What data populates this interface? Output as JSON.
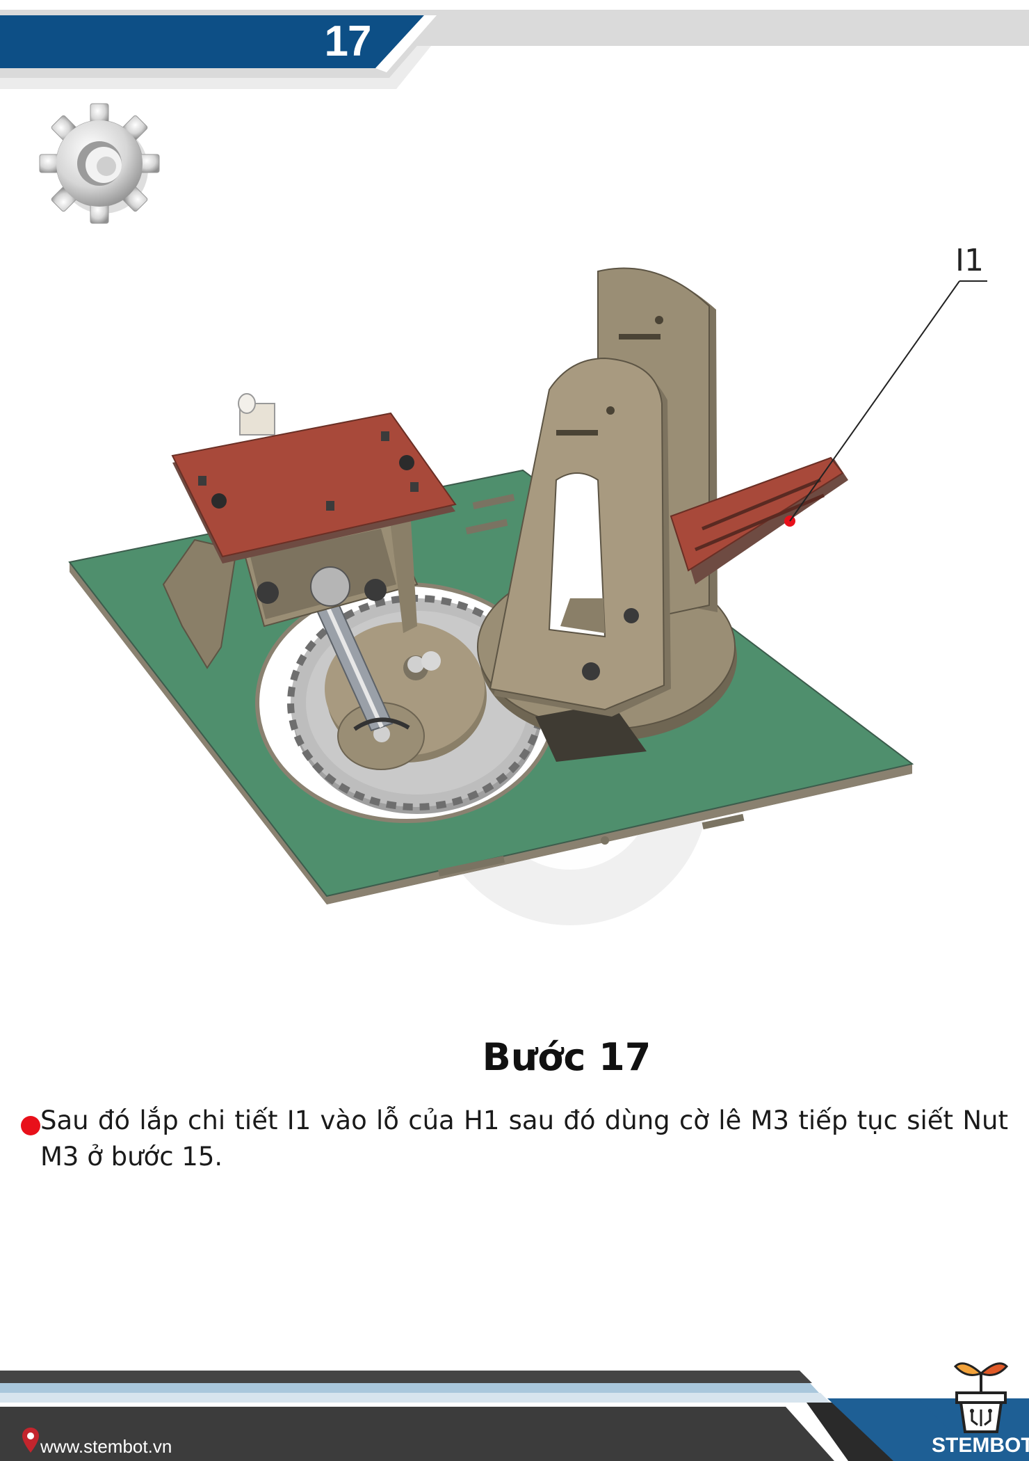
{
  "header": {
    "page_number": "17",
    "colors": {
      "primary": "#0d4f86",
      "gray": "#d9d9d9"
    },
    "icon": "gear-icon"
  },
  "illustration": {
    "part_label": "I1",
    "colors": {
      "base": "#4f8f6d",
      "wood": "#8c7f66",
      "red_part": "#a8493a",
      "gear": "#b9b9b9",
      "marker": "#e8101a"
    }
  },
  "step": {
    "title": "Bước 17",
    "description": "Sau đó lắp chi tiết I1 vào lỗ của H1 sau đó dùng cờ lê M3 tiếp tục siết Nut M3 ở bước 15."
  },
  "footer": {
    "url": "www.stembot.vn",
    "brand": "STEMBOT",
    "icons": [
      "location-pin-icon",
      "plant-pot-logo-icon"
    ],
    "colors": {
      "dark": "#3c3c3c",
      "blue": "#1e5f95",
      "light_blue": "#a9c7dc"
    }
  }
}
